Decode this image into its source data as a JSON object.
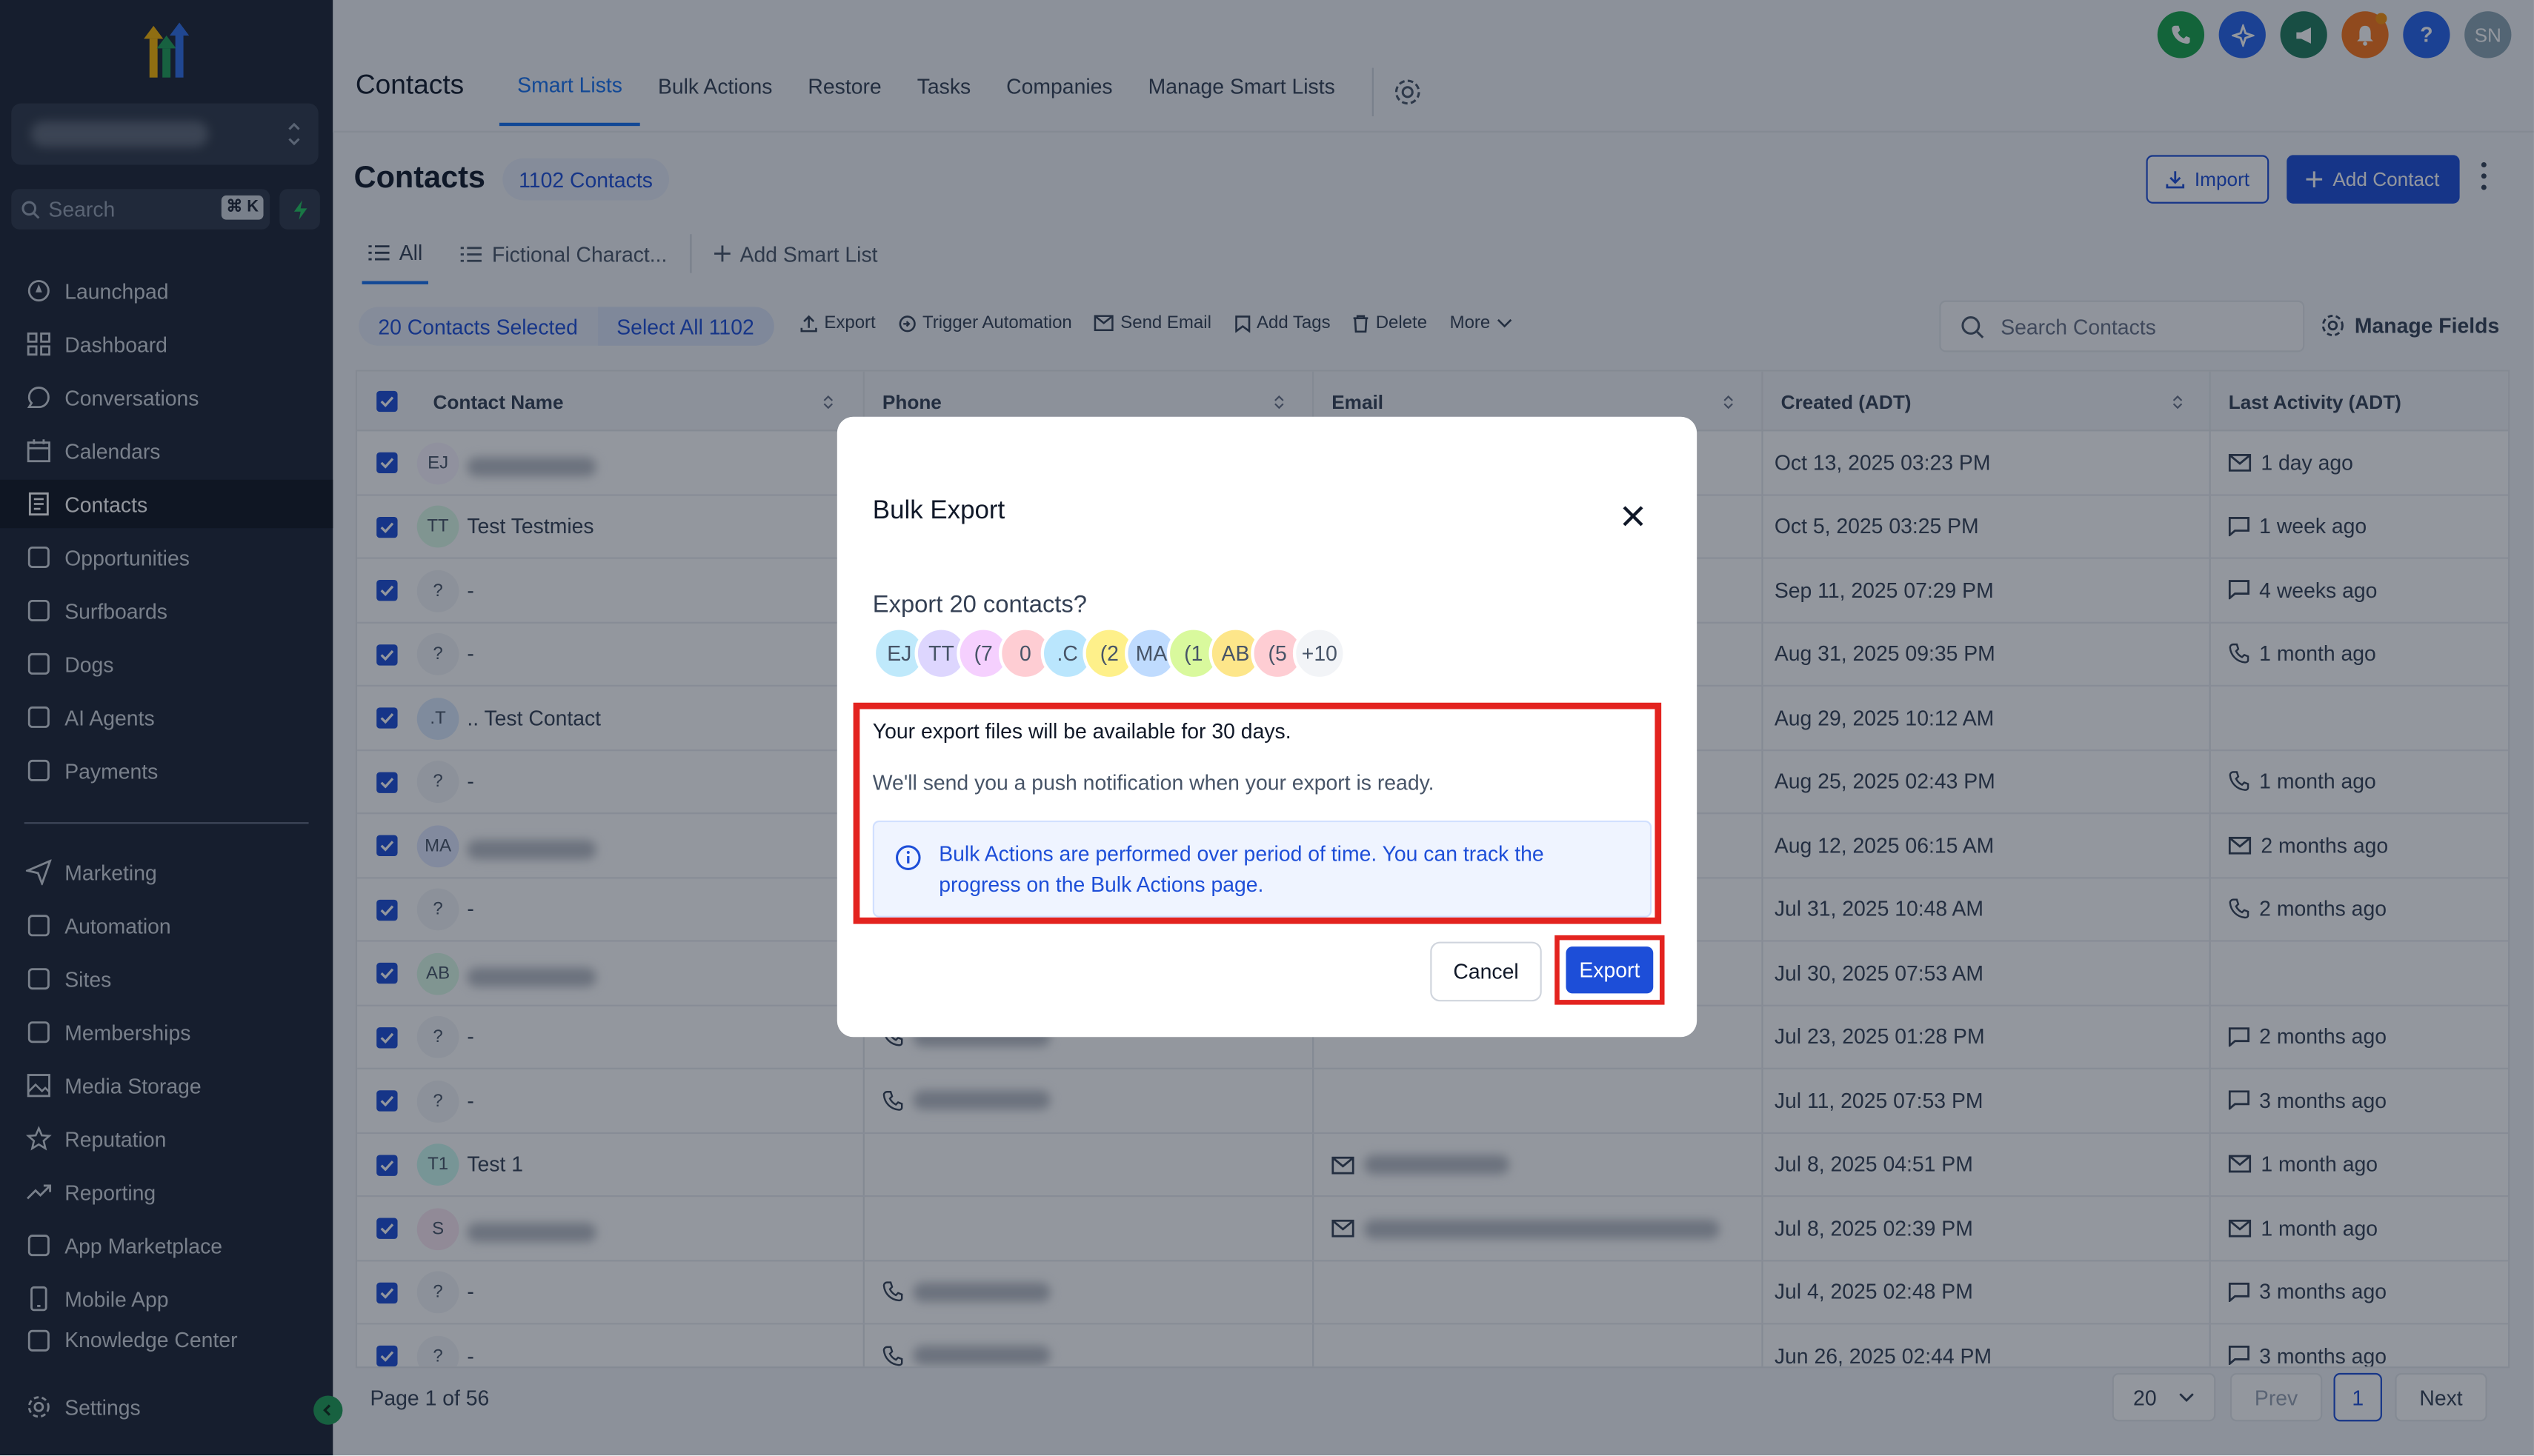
{
  "sidebar": {
    "search_placeholder": "Search",
    "shortcut": "⌘ K",
    "items": [
      {
        "label": "Launchpad",
        "icon": "rocket-icon"
      },
      {
        "label": "Dashboard",
        "icon": "grid-icon"
      },
      {
        "label": "Conversations",
        "icon": "chat-icon"
      },
      {
        "label": "Calendars",
        "icon": "calendar-icon"
      },
      {
        "label": "Contacts",
        "icon": "contacts-icon"
      },
      {
        "label": "Opportunities",
        "icon": "network-icon"
      },
      {
        "label": "Surfboards",
        "icon": "surfboard-icon"
      },
      {
        "label": "Dogs",
        "icon": "paw-icon"
      },
      {
        "label": "AI Agents",
        "icon": "sparkle-icon"
      },
      {
        "label": "Payments",
        "icon": "receipt-icon"
      },
      {
        "label": "Marketing",
        "icon": "send-icon"
      },
      {
        "label": "Automation",
        "icon": "automation-icon"
      },
      {
        "label": "Sites",
        "icon": "sites-icon"
      },
      {
        "label": "Memberships",
        "icon": "membership-icon"
      },
      {
        "label": "Media Storage",
        "icon": "image-icon"
      },
      {
        "label": "Reputation",
        "icon": "star-icon"
      },
      {
        "label": "Reporting",
        "icon": "trend-icon"
      },
      {
        "label": "App Marketplace",
        "icon": "apps-icon"
      },
      {
        "label": "Mobile App",
        "icon": "phone-device-icon"
      },
      {
        "label": "Knowledge Center",
        "icon": "book-icon"
      }
    ],
    "settings": "Settings"
  },
  "header": {
    "tabs": [
      "Contacts",
      "Smart Lists",
      "Bulk Actions",
      "Restore",
      "Tasks",
      "Companies",
      "Manage Smart Lists"
    ],
    "avatar_initials": "SN",
    "help": "?"
  },
  "page": {
    "title": "Contacts",
    "count_badge": "1102 Contacts",
    "import_label": "Import",
    "add_label": "Add Contact",
    "smartlist_tabs": [
      "All",
      "Fictional Charact..."
    ],
    "add_smart_list": "Add Smart List"
  },
  "actionbar": {
    "selected": "20 Contacts Selected",
    "select_all": "Select All 1102",
    "actions": [
      "Export",
      "Trigger Automation",
      "Send Email",
      "Add Tags",
      "Delete",
      "More"
    ],
    "search_placeholder": "Search Contacts",
    "manage_fields": "Manage Fields"
  },
  "table": {
    "columns": [
      "Contact Name",
      "Phone",
      "Email",
      "Created (ADT)",
      "Last Activity (ADT)"
    ],
    "rows": [
      {
        "initials": "EJ",
        "name": "",
        "created": "Oct 13, 2025 03:23 PM",
        "activity": "1 day ago",
        "act_icon": "mail-icon",
        "phone": false,
        "email": false,
        "avatar_color": "#f9f5ff"
      },
      {
        "initials": "TT",
        "name": "Test Testmies",
        "created": "Oct 5, 2025 03:25 PM",
        "activity": "1 week ago",
        "act_icon": "chat-icon",
        "phone": false,
        "email": false,
        "avatar_color": "#dcfce7"
      },
      {
        "initials": "?",
        "name": "-",
        "created": "Sep 11, 2025 07:29 PM",
        "activity": "4 weeks ago",
        "act_icon": "chat-icon",
        "phone": false,
        "email": false,
        "avatar_color": "#f2f4f7"
      },
      {
        "initials": "?",
        "name": "-",
        "created": "Aug 31, 2025 09:35 PM",
        "activity": "1 month ago",
        "act_icon": "phone-icon",
        "phone": false,
        "email": false,
        "avatar_color": "#f2f4f7"
      },
      {
        "initials": ".T",
        "name": ".. Test Contact",
        "created": "Aug 29, 2025 10:12 AM",
        "activity": "",
        "act_icon": "",
        "phone": false,
        "email": false,
        "avatar_color": "#dbeafe"
      },
      {
        "initials": "?",
        "name": "-",
        "created": "Aug 25, 2025 02:43 PM",
        "activity": "1 month ago",
        "act_icon": "phone-icon",
        "phone": false,
        "email": false,
        "avatar_color": "#f2f4f7"
      },
      {
        "initials": "MA",
        "name": "",
        "created": "Aug 12, 2025 06:15 AM",
        "activity": "2 months ago",
        "act_icon": "mail-icon",
        "phone": false,
        "email": false,
        "avatar_color": "#e0e7ff"
      },
      {
        "initials": "?",
        "name": "-",
        "created": "Jul 31, 2025 10:48 AM",
        "activity": "2 months ago",
        "act_icon": "phone-icon",
        "phone": false,
        "email": false,
        "avatar_color": "#f2f4f7"
      },
      {
        "initials": "AB",
        "name": "",
        "created": "Jul 30, 2025 07:53 AM",
        "activity": "",
        "act_icon": "",
        "phone": false,
        "email": false,
        "avatar_color": "#dcfce7"
      },
      {
        "initials": "?",
        "name": "-",
        "created": "Jul 23, 2025 01:28 PM",
        "activity": "2 months ago",
        "act_icon": "chat-icon",
        "phone": true,
        "email": false,
        "avatar_color": "#f2f4f7"
      },
      {
        "initials": "?",
        "name": "-",
        "created": "Jul 11, 2025 07:53 PM",
        "activity": "3 months ago",
        "act_icon": "chat-icon",
        "phone": true,
        "email": false,
        "avatar_color": "#f2f4f7"
      },
      {
        "initials": "T1",
        "name": "Test 1",
        "created": "Jul 8, 2025 04:51 PM",
        "activity": "1 month ago",
        "act_icon": "mail-icon",
        "phone": false,
        "email": true,
        "avatar_color": "#ccfbf1"
      },
      {
        "initials": "S",
        "name": "",
        "created": "Jul 8, 2025 02:39 PM",
        "activity": "1 month ago",
        "act_icon": "mail-icon",
        "phone": false,
        "email": true,
        "avatar_color": "#fce7f3"
      },
      {
        "initials": "?",
        "name": "-",
        "created": "Jul 4, 2025 02:48 PM",
        "activity": "3 months ago",
        "act_icon": "chat-icon",
        "phone": true,
        "email": false,
        "avatar_color": "#f2f4f7"
      },
      {
        "initials": "?",
        "name": "-",
        "created": "Jun 26, 2025 02:44 PM",
        "activity": "3 months ago",
        "act_icon": "chat-icon",
        "phone": true,
        "email": false,
        "avatar_color": "#f2f4f7"
      }
    ]
  },
  "footer": {
    "page_info": "Page 1 of 56",
    "per_page": "20",
    "prev": "Prev",
    "current": "1",
    "next": "Next"
  },
  "modal": {
    "title": "Bulk Export",
    "question": "Export 20 contacts?",
    "avatars": [
      {
        "text": "EJ",
        "color": "#bfe9fb"
      },
      {
        "text": "TT",
        "color": "#ddd6fe"
      },
      {
        "text": "(7",
        "color": "#f5d0fe"
      },
      {
        "text": "0",
        "color": "#fecdd3"
      },
      {
        "text": ".C",
        "color": "#bae6fd"
      },
      {
        "text": "(2",
        "color": "#fef08a"
      },
      {
        "text": "MA",
        "color": "#bfdbfe"
      },
      {
        "text": "(1",
        "color": "#d9f99d"
      },
      {
        "text": "AB",
        "color": "#fde68a"
      },
      {
        "text": "(5",
        "color": "#fecdd3"
      },
      {
        "text": "+10",
        "color": "#f2f4f7"
      }
    ],
    "line1": "Your export files will be available for 30 days.",
    "line2": "We'll send you a push notification when your export is ready.",
    "info": "Bulk Actions are performed over period of time. You can track the progress on the Bulk Actions page.",
    "cancel": "Cancel",
    "export": "Export"
  }
}
